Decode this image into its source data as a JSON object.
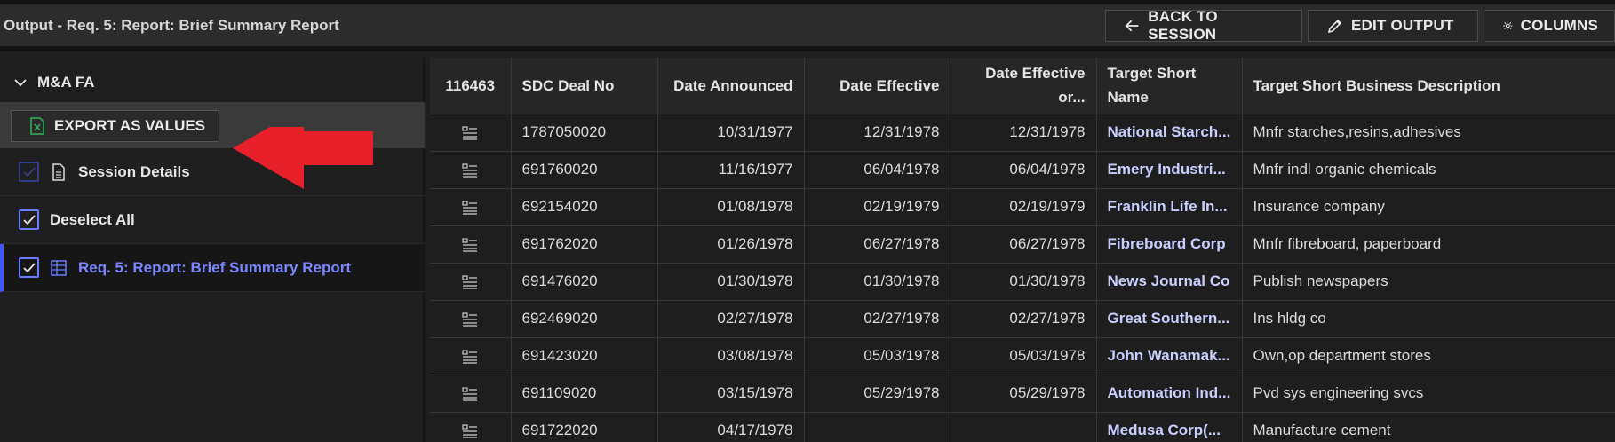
{
  "header": {
    "title": "Output - Req. 5: Report: Brief Summary Report",
    "back_label": "BACK TO SESSION",
    "edit_label": "EDIT OUTPUT",
    "columns_label": "COLUMNS"
  },
  "sidebar": {
    "group_label": "M&A FA",
    "export_label": "EXPORT AS VALUES",
    "items": [
      {
        "label": "Session Details"
      },
      {
        "label": "Deselect All"
      },
      {
        "label": "Req. 5: Report: Brief Summary Report"
      }
    ]
  },
  "table": {
    "headers": [
      "116463",
      "SDC Deal No",
      "Date Announced",
      "Date Effective",
      "Date Effective or...",
      "Target Short Name",
      "Target Short Business Description"
    ],
    "rows": [
      [
        "1787050020",
        "10/31/1977",
        "12/31/1978",
        "12/31/1978",
        "National Starch...",
        "Mnfr starches,resins,adhesives"
      ],
      [
        "691760020",
        "11/16/1977",
        "06/04/1978",
        "06/04/1978",
        "Emery Industri...",
        "Mnfr indl organic chemicals"
      ],
      [
        "692154020",
        "01/08/1978",
        "02/19/1979",
        "02/19/1979",
        "Franklin Life In...",
        "Insurance company"
      ],
      [
        "691762020",
        "01/26/1978",
        "06/27/1978",
        "06/27/1978",
        "Fibreboard Corp",
        "Mnfr fibreboard, paperboard"
      ],
      [
        "691476020",
        "01/30/1978",
        "01/30/1978",
        "01/30/1978",
        "News Journal Co",
        "Publish newspapers"
      ],
      [
        "692469020",
        "02/27/1978",
        "02/27/1978",
        "02/27/1978",
        "Great Southern...",
        "Ins hldg co"
      ],
      [
        "691423020",
        "03/08/1978",
        "05/03/1978",
        "05/03/1978",
        "John Wanamak...",
        "Own,op department stores"
      ],
      [
        "691109020",
        "03/15/1978",
        "05/29/1978",
        "05/29/1978",
        "Automation Ind...",
        "Pvd sys engineering svcs"
      ],
      [
        "691722020",
        "04/17/1978",
        "",
        "",
        "Medusa Corp(...",
        "Manufacture cement"
      ]
    ]
  },
  "colors": {
    "accent": "#3f57ff",
    "link": "#c9d0ff",
    "arrow": "#e8202a"
  }
}
